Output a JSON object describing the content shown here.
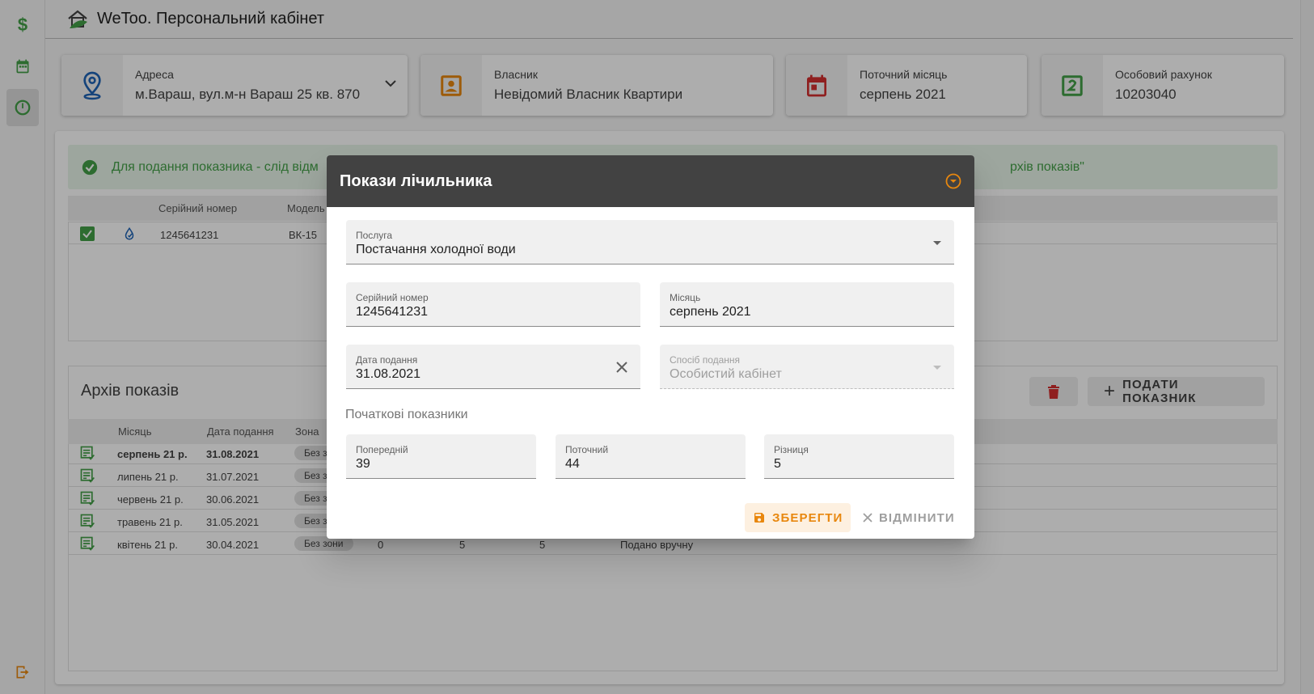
{
  "app": {
    "title": "WeToo. Персональний кабінет"
  },
  "cards": {
    "address": {
      "label": "Адреса",
      "value": "м.Вараш, вул.м-н Вараш 25 кв. 870"
    },
    "owner": {
      "label": "Власник",
      "value": "Невідомий Власник Квартири"
    },
    "month": {
      "label": "Поточний місяць",
      "value": "серпень 2021"
    },
    "account": {
      "label": "Особовий рахунок",
      "value": "10203040"
    }
  },
  "alert": {
    "text_left": "Для подання показника - слід відм",
    "text_right": "рхів показів\""
  },
  "meters": {
    "headers": {
      "serial": "Серійний номер",
      "model": "Модель"
    },
    "rows": [
      {
        "serial": "1245641231",
        "model": "ВК-15"
      }
    ]
  },
  "archive": {
    "title": "Архів показів",
    "submit_label": "ПОДАТИ ПОКАЗНИК",
    "headers": {
      "month": "Місяць",
      "date": "Дата подання",
      "zone": "Зона"
    },
    "rows": [
      {
        "month": "серпень 21 р.",
        "date": "31.08.2021",
        "zone": "Без з"
      },
      {
        "month": "липень 21 р.",
        "date": "31.07.2021",
        "zone": "Без з"
      },
      {
        "month": "червень 21 р.",
        "date": "30.06.2021",
        "zone": "Без з"
      },
      {
        "month": "травень 21 р.",
        "date": "31.05.2021",
        "zone": "Без з"
      },
      {
        "month": "квітень 21 р.",
        "date": "30.04.2021",
        "zone": "Без зони",
        "prev": "0",
        "cur": "5",
        "diff": "5",
        "status": "Подано вручну"
      }
    ]
  },
  "dialog": {
    "title": "Покази лічильника",
    "service": {
      "label": "Послуга",
      "value": "Постачання холодної води"
    },
    "serial": {
      "label": "Серійний номер",
      "value": "1245641231"
    },
    "month": {
      "label": "Місяць",
      "value": "серпень 2021"
    },
    "date": {
      "label": "Дата подання",
      "value": "31.08.2021"
    },
    "method": {
      "label": "Спосіб подання",
      "value": "Особистий кабінет"
    },
    "section_title": "Початкові показники",
    "previous": {
      "label": "Попередній",
      "value": "39"
    },
    "current": {
      "label": "Поточний",
      "value": "44"
    },
    "difference": {
      "label": "Різниця",
      "value": "5"
    },
    "save_label": "ЗБЕРЕГТИ",
    "cancel_label": "ВІДМІНИТИ"
  },
  "colors": {
    "accent": "#e8870e",
    "green": "#43a047",
    "red": "#d32f2f",
    "blue": "#1e63b5",
    "dark": "#424242"
  }
}
